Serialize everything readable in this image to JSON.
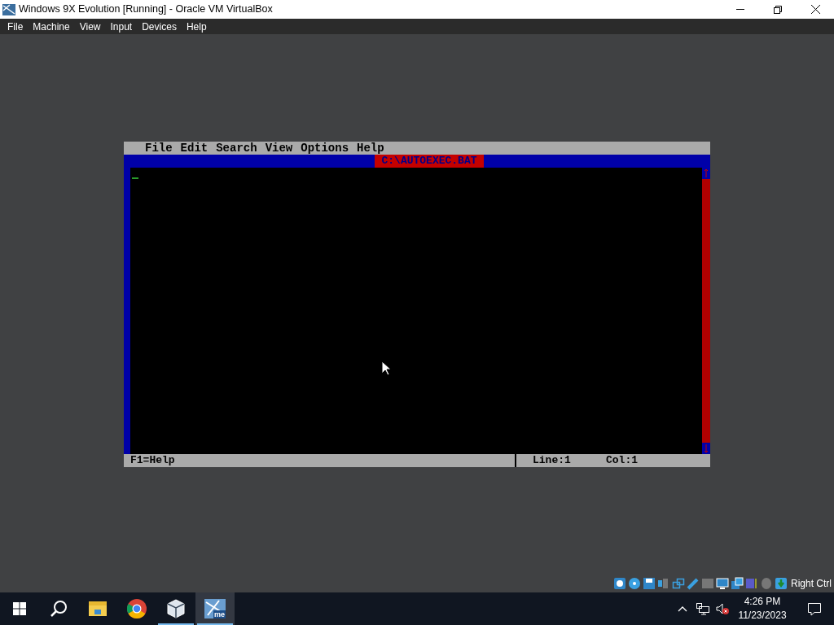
{
  "window": {
    "title": "Windows 9X Evolution [Running] - Oracle VM VirtualBox"
  },
  "menu": [
    "File",
    "Machine",
    "View",
    "Input",
    "Devices",
    "Help"
  ],
  "guest": {
    "menu": [
      "File",
      "Edit",
      "Search",
      "View",
      "Options",
      "Help"
    ],
    "document_title": "C:\\AUTOEXEC.BAT",
    "status_help": "F1=Help",
    "status_line": "Line:1",
    "status_col": "Col:1"
  },
  "host_key": "Right Ctrl",
  "taskbar": {
    "apps": [
      {
        "kind": "search",
        "selected": false
      },
      {
        "kind": "folder",
        "selected": false
      },
      {
        "kind": "browser",
        "selected": false
      },
      {
        "kind": "cube",
        "selected": true
      },
      {
        "kind": "vm",
        "selected": true
      }
    ],
    "vm_badge": "me",
    "time": "4:26 PM",
    "date": "11/23/2023"
  }
}
